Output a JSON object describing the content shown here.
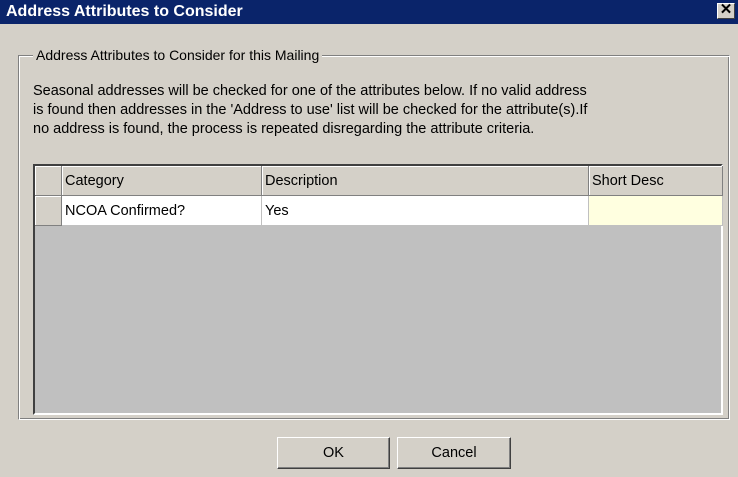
{
  "window": {
    "title": "Address Attributes to Consider",
    "close_icon": "close-icon"
  },
  "group": {
    "label": "Address Attributes to Consider for this Mailing"
  },
  "description": {
    "line1": "Seasonal addresses will be checked for one of the attributes below.  If no valid address",
    "line2": "is found then addresses in the 'Address to use' list will be checked for the attribute(s).If",
    "line3": "no address is found, the process is repeated disregarding the attribute criteria."
  },
  "grid": {
    "columns": [
      "Category",
      "Description",
      "Short Desc"
    ],
    "rows": [
      {
        "category": "NCOA Confirmed?",
        "description": "Yes",
        "short_desc": ""
      }
    ]
  },
  "buttons": {
    "ok": "OK",
    "cancel": "Cancel"
  },
  "colors": {
    "titlebar": "#0a246a",
    "face": "#d4d0c8",
    "grid_empty": "#c0c0c0",
    "short_desc_cell": "#ffffe0"
  }
}
